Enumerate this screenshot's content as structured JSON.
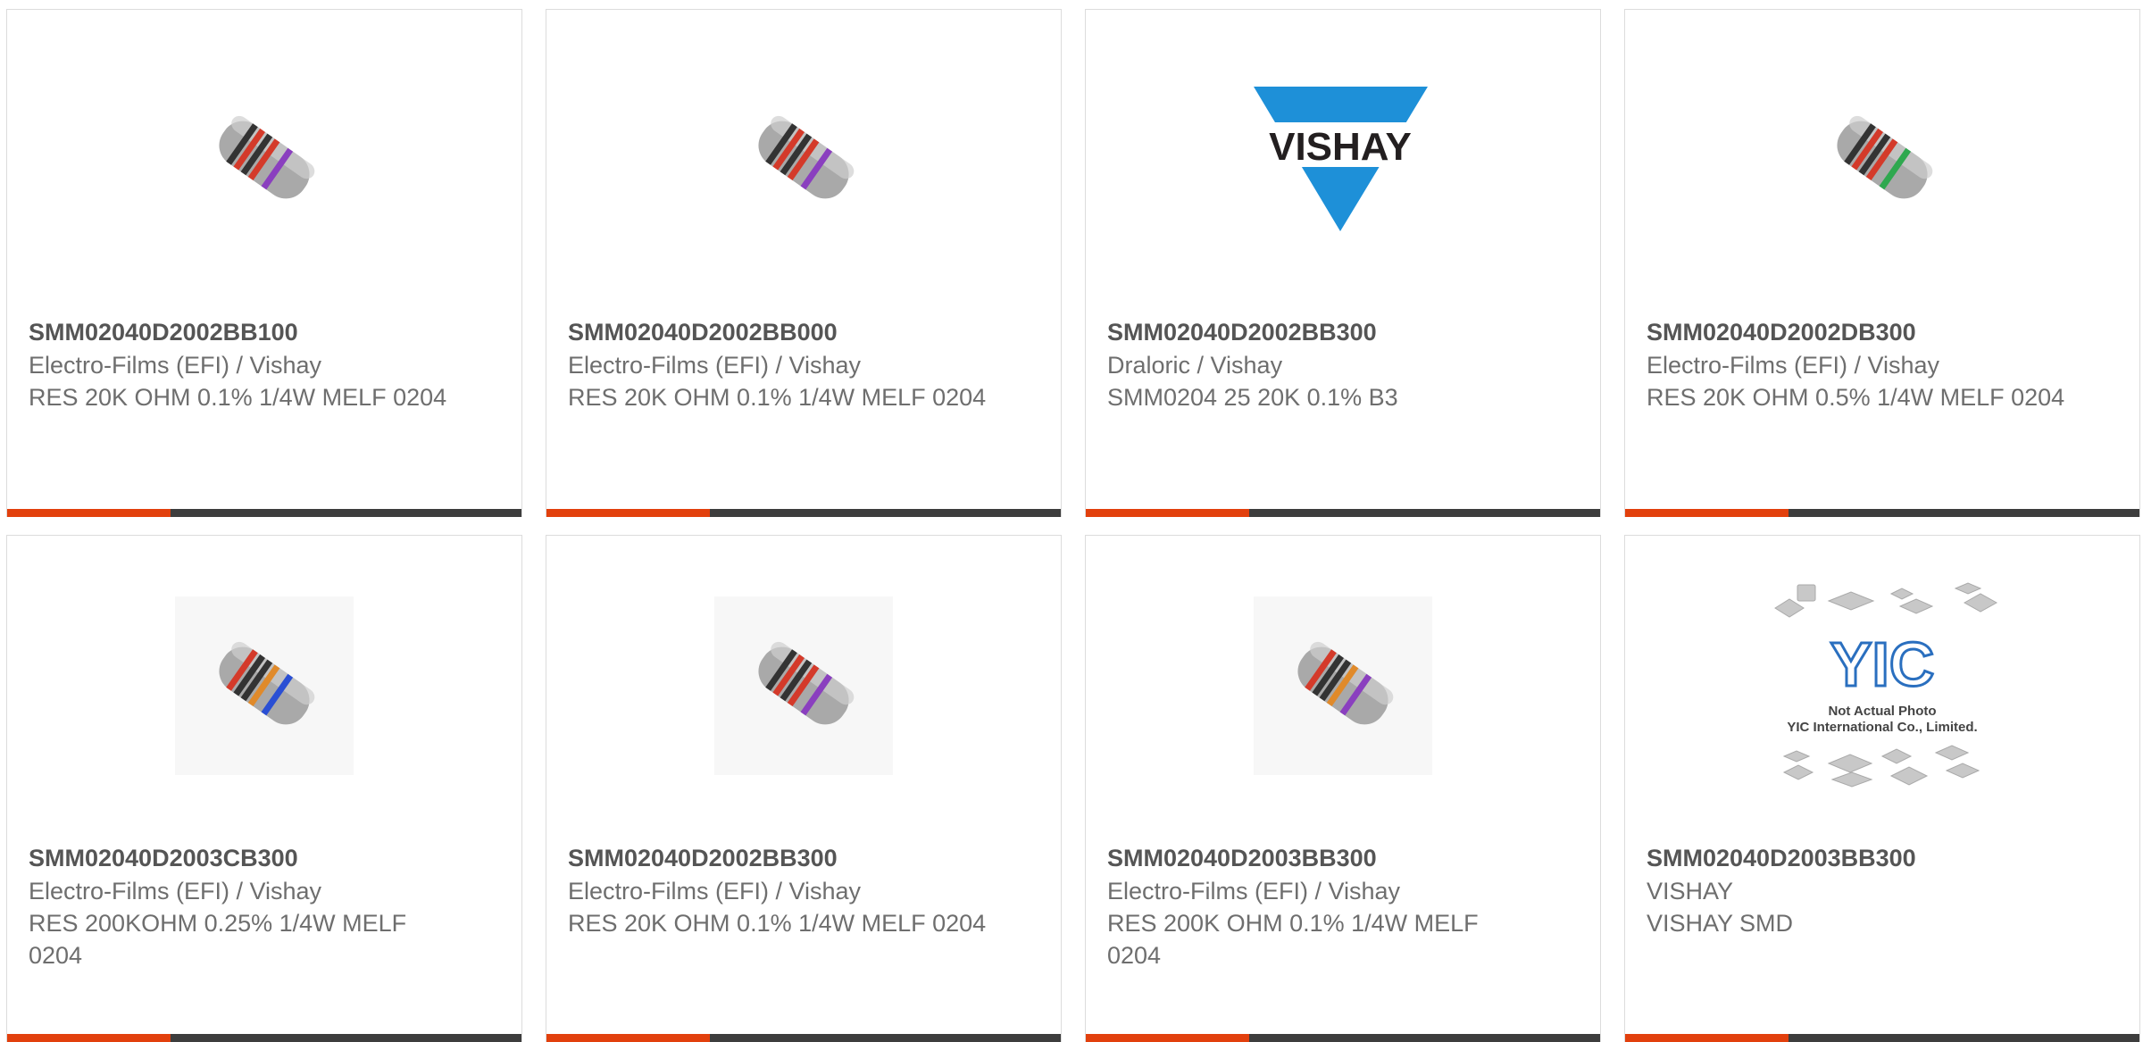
{
  "colors": {
    "accent": "#e2400d",
    "bar": "#3d3d3d",
    "border": "#dcdcdc",
    "title": "#555555",
    "text": "#6e6e6e",
    "vishay_blue": "#1e90d8"
  },
  "cards": [
    {
      "part": "SMM02040D2002BB100",
      "manufacturer": "Electro-Films (EFI) / Vishay",
      "description": "RES 20K OHM 0.1% 1/4W MELF 0204",
      "image": "resistor-image"
    },
    {
      "part": "SMM02040D2002BB000",
      "manufacturer": "Electro-Films (EFI) / Vishay",
      "description": "RES 20K OHM 0.1% 1/4W MELF 0204",
      "image": "resistor-image"
    },
    {
      "part": "SMM02040D2002BB300",
      "manufacturer": "Draloric / Vishay",
      "description": "SMM0204 25 20K 0.1% B3",
      "image": "vishay-logo",
      "logo_text": "VISHAY"
    },
    {
      "part": "SMM02040D2002DB300",
      "manufacturer": "Electro-Films (EFI) / Vishay",
      "description": "RES 20K OHM 0.5% 1/4W MELF 0204",
      "image": "resistor-image"
    },
    {
      "part": "SMM02040D2003CB300",
      "manufacturer": "Electro-Films (EFI) / Vishay",
      "description": "RES 200KOHM 0.25% 1/4W MELF 0204",
      "image": "resistor-image"
    },
    {
      "part": "SMM02040D2002BB300",
      "manufacturer": "Electro-Films (EFI) / Vishay",
      "description": "RES 20K OHM 0.1% 1/4W MELF 0204",
      "image": "resistor-image"
    },
    {
      "part": "SMM02040D2003BB300",
      "manufacturer": "Electro-Films (EFI) / Vishay",
      "description": "RES 200K OHM 0.1% 1/4W MELF 0204",
      "image": "resistor-image"
    },
    {
      "part": "SMM02040D2003BB300",
      "manufacturer": "VISHAY",
      "description": "VISHAY SMD",
      "image": "yic-placeholder",
      "logo_text": "YIC",
      "caption_1": "Not Actual Photo",
      "caption_2": "YIC International Co., Limited."
    }
  ]
}
